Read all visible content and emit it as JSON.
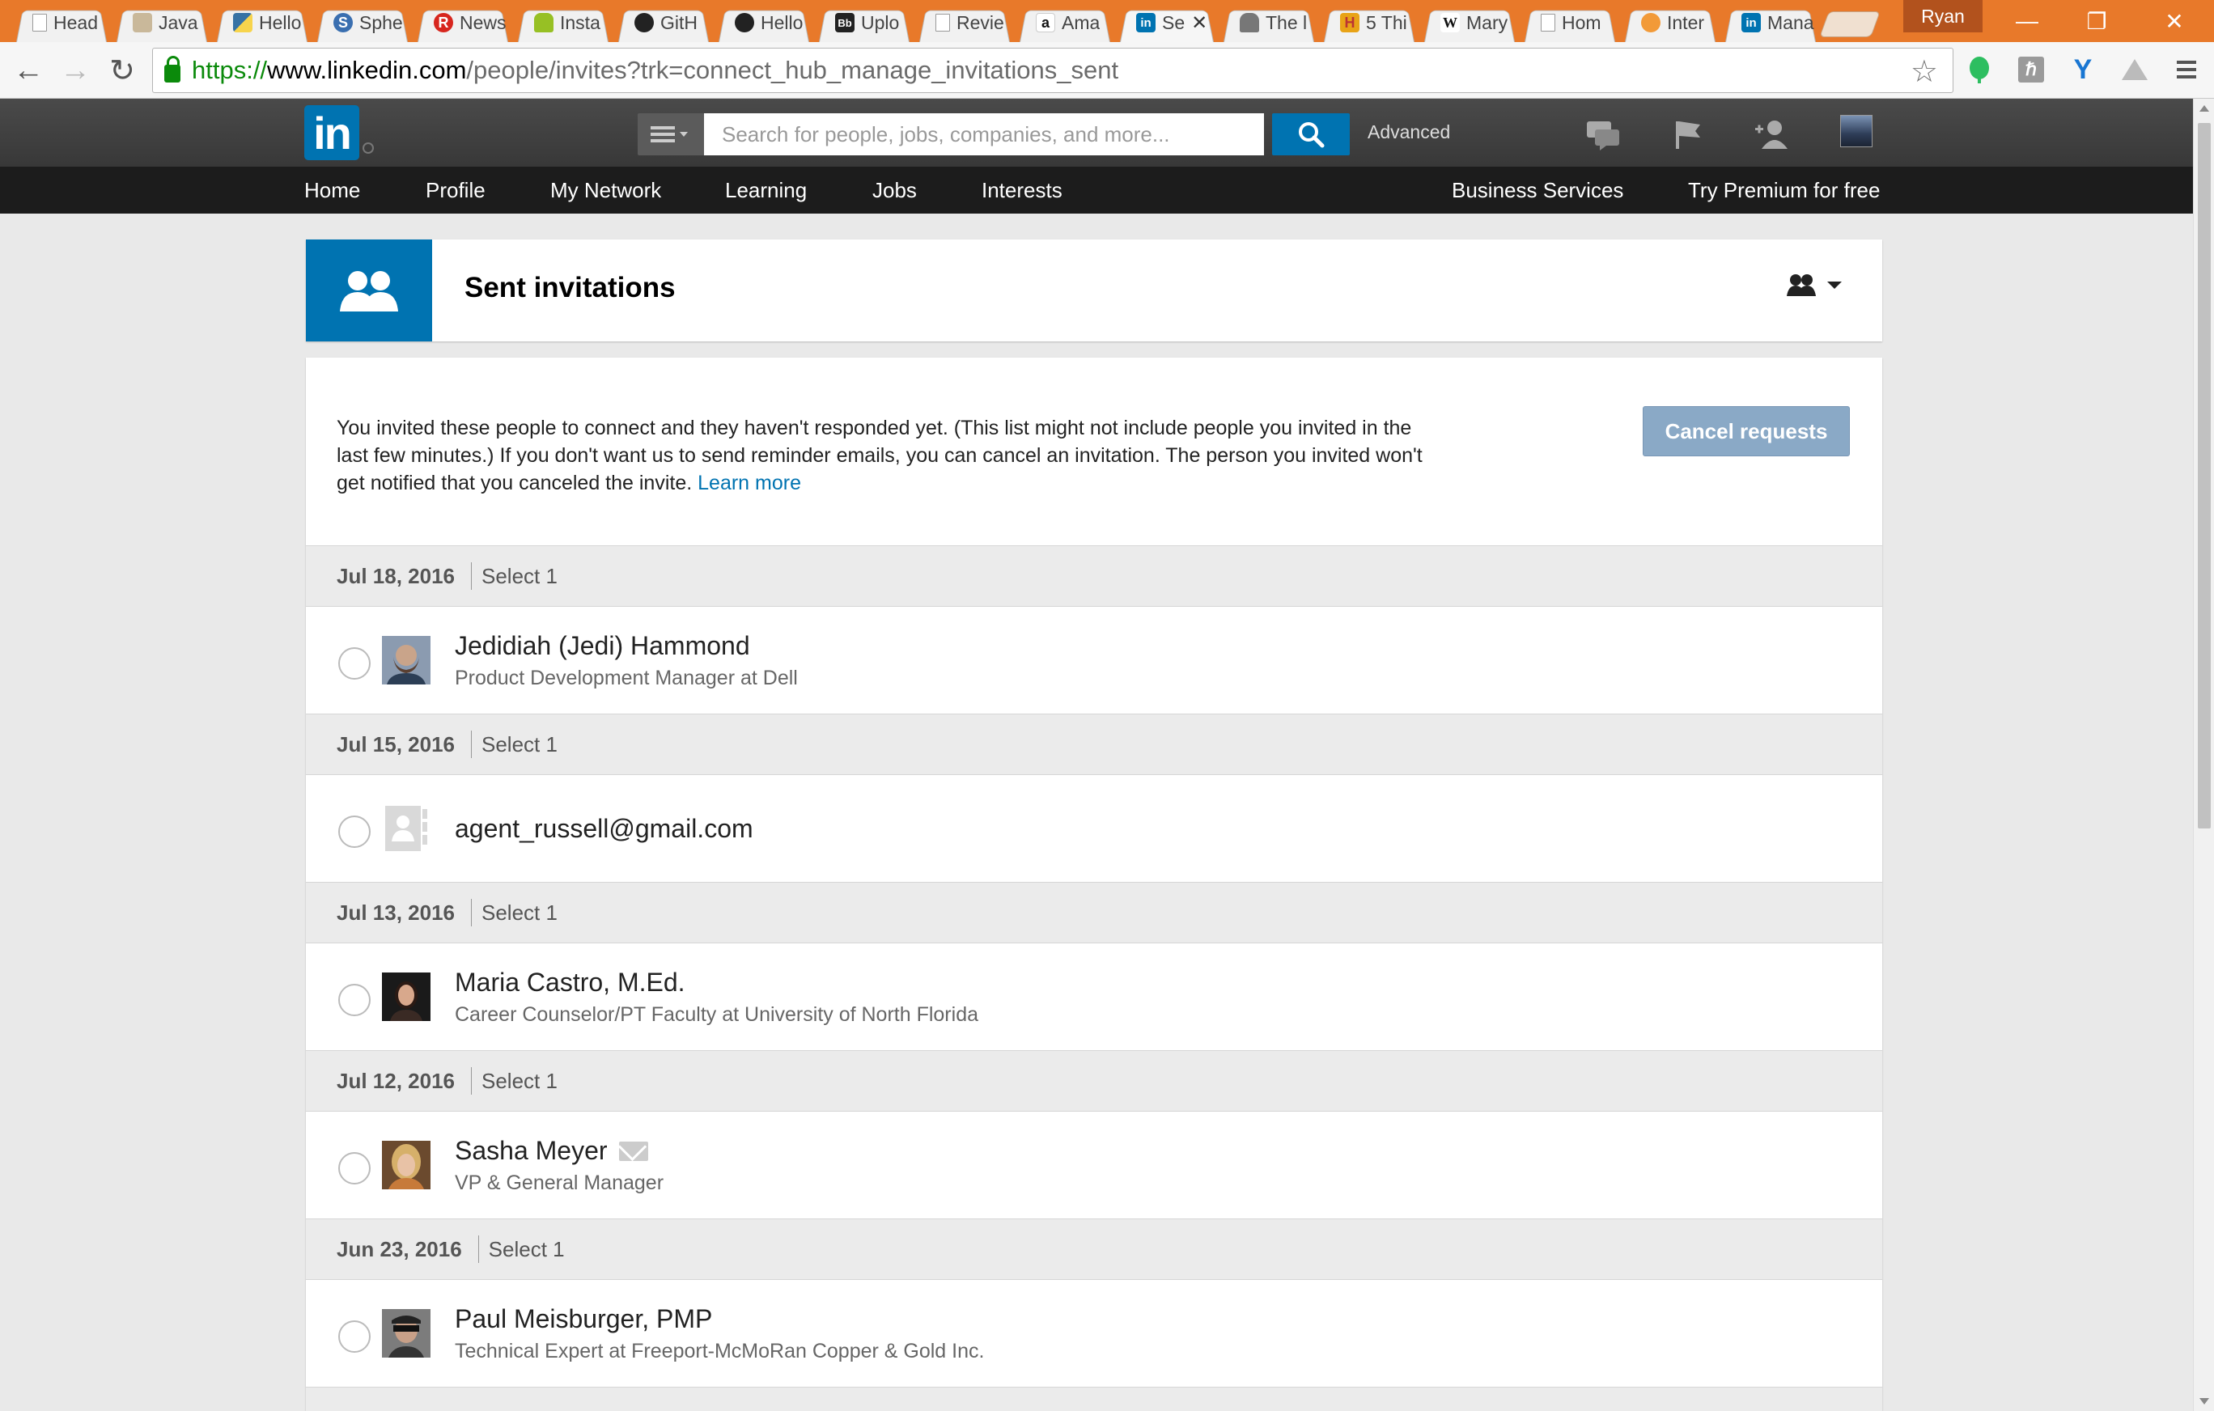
{
  "browser": {
    "tabs": [
      {
        "label": "Head",
        "icon": "page-icon"
      },
      {
        "label": "Java",
        "icon": "image-icon"
      },
      {
        "label": "Hello",
        "icon": "python-icon"
      },
      {
        "label": "Sphe",
        "icon": "s-icon"
      },
      {
        "label": "News",
        "icon": "r-icon"
      },
      {
        "label": "Insta",
        "icon": "android-icon"
      },
      {
        "label": "GitH",
        "icon": "github-icon"
      },
      {
        "label": "Hello",
        "icon": "github-icon"
      },
      {
        "label": "Uplo",
        "icon": "bb-icon"
      },
      {
        "label": "Revie",
        "icon": "page-icon"
      },
      {
        "label": "Ama",
        "icon": "amazon-icon"
      },
      {
        "label": "Se",
        "icon": "linkedin-icon",
        "active": true
      },
      {
        "label": "The l",
        "icon": "thumb-icon"
      },
      {
        "label": "5 Thi",
        "icon": "h-icon"
      },
      {
        "label": "Mary",
        "icon": "wikipedia-icon"
      },
      {
        "label": "Hom",
        "icon": "page-icon"
      },
      {
        "label": "Inter",
        "icon": "feed-icon"
      },
      {
        "label": "Mana",
        "icon": "linkedin-icon"
      }
    ],
    "profile_name": "Ryan",
    "url_https": "https://",
    "url_host": "www.linkedin.com",
    "url_path": "/people/invites?trk=connect_hub_manage_invitations_sent",
    "colors": {
      "titlebar": "#e8792a",
      "secure": "#0b8a0b"
    }
  },
  "linkedin": {
    "logo": "in",
    "search_placeholder": "Search for people, jobs, companies, and more...",
    "advanced_label": "Advanced",
    "nav": {
      "home": "Home",
      "profile": "Profile",
      "my_network": "My Network",
      "learning": "Learning",
      "jobs": "Jobs",
      "interests": "Interests",
      "business_services": "Business Services",
      "premium": "Try Premium for free"
    },
    "brand_color": "#0073b1"
  },
  "page": {
    "title": "Sent invitations",
    "intro_text": "You invited these people to connect and they haven't responded yet. (This list might not include people you invited in the last few minutes.) If you don't want us to send reminder emails, you can cancel an invitation. The person you invited won't get notified that you canceled the invite. ",
    "learn_more": "Learn more",
    "cancel_button": "Cancel requests",
    "select_label": "Select 1",
    "groups": [
      {
        "date": "Jul 18, 2016",
        "name": "Jedidiah (Jedi) Hammond",
        "title": "Product Development Manager at Dell"
      },
      {
        "date": "Jul 15, 2016",
        "name": "agent_russell@gmail.com",
        "title": ""
      },
      {
        "date": "Jul 13, 2016",
        "name": "Maria Castro, M.Ed.",
        "title": "Career Counselor/PT Faculty at University of North Florida"
      },
      {
        "date": "Jul 12, 2016",
        "name": "Sasha Meyer",
        "title": "VP & General Manager"
      },
      {
        "date": "Jun 23, 2016",
        "name": "Paul Meisburger, PMP",
        "title": "Technical Expert at Freeport-McMoRan Copper & Gold Inc."
      }
    ]
  }
}
